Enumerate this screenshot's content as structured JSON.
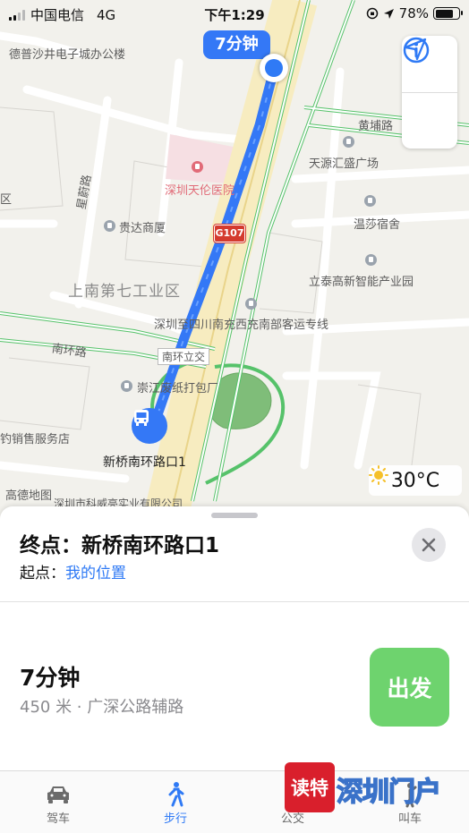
{
  "status_bar": {
    "carrier": "中国电信",
    "network": "4G",
    "time": "下午1:29",
    "battery": "78%"
  },
  "map": {
    "eta_label": "7分钟",
    "road_shield": "G107",
    "pois": {
      "desheng": "德普沙井电子城办公楼",
      "hospital": "深圳天伦医院",
      "guida": "贵达商厦",
      "tianyuan": "天源汇盛广场",
      "wensha": "温莎宿舍",
      "litai": "立泰高新智能产业园",
      "district": "上南第七工业区",
      "bus_line": "深圳至四川南充西充南部客运专线",
      "interchange": "南环立交",
      "recycling": "崇江废纸打包厂",
      "sales": "钓销售服务店",
      "gaode": "高德地图",
      "company": "深圳市科威亮实业有限公司",
      "destination": "新桥南环路口1",
      "road_nanhuan": "南环路",
      "road_xingwei": "星蔚路",
      "road_huangpu": "黄埔路",
      "road_qu": "区"
    },
    "weather_temp": "30°C",
    "icons": {
      "info": "info-icon",
      "locate": "location-arrow-icon",
      "bus": "bus-icon"
    }
  },
  "sheet": {
    "destination_prefix": "终点：",
    "destination": "新桥南环路口1",
    "origin_prefix": "起点：",
    "origin": "我的位置",
    "route_time": "7分钟",
    "route_detail": "450 米 · 广深公路辅路",
    "go_label": "出发"
  },
  "tabs": [
    {
      "label": "驾车",
      "icon": "car-icon"
    },
    {
      "label": "步行",
      "icon": "walk-icon"
    },
    {
      "label": "公交",
      "icon": "bus-icon"
    },
    {
      "label": "叫车",
      "icon": "taxi-icon"
    }
  ],
  "watermark": {
    "badge": "读特",
    "text": "深圳门户"
  },
  "colors": {
    "route_blue": "#3478f6",
    "go_green": "#6ed36e",
    "road_green": "#56c26a",
    "shield_red": "#d43a2e"
  }
}
